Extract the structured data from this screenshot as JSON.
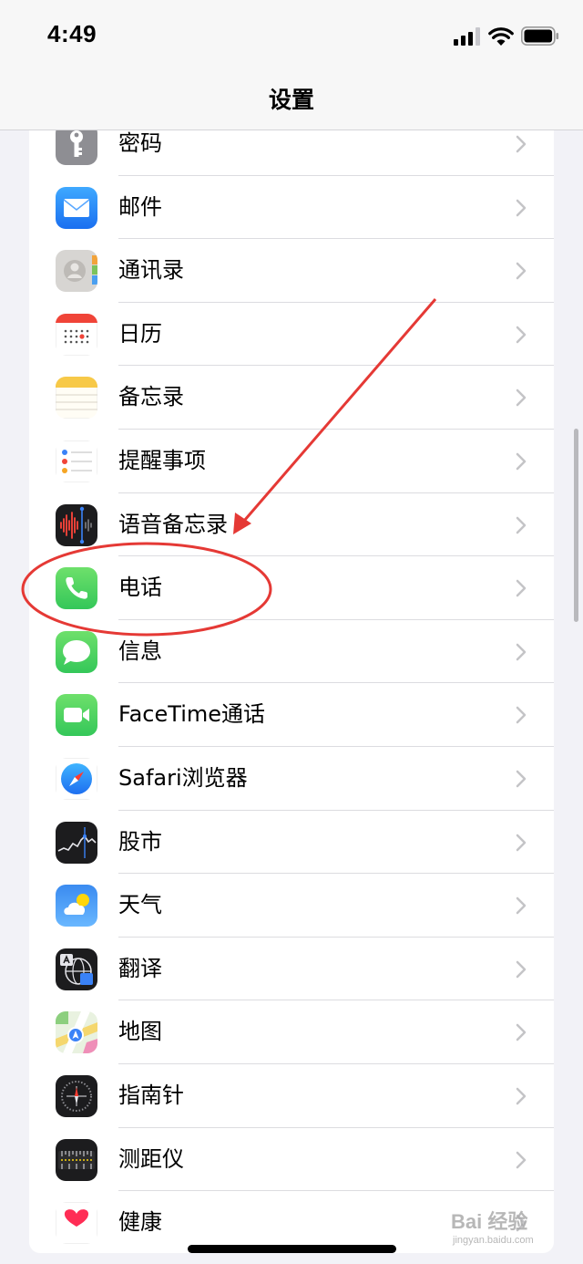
{
  "status_bar": {
    "time": "4:49"
  },
  "nav": {
    "title": "设置"
  },
  "items": [
    {
      "id": "passwords",
      "label": "密码",
      "icon": "key-icon"
    },
    {
      "id": "mail",
      "label": "邮件",
      "icon": "mail-icon"
    },
    {
      "id": "contacts",
      "label": "通讯录",
      "icon": "contacts-icon"
    },
    {
      "id": "calendar",
      "label": "日历",
      "icon": "calendar-icon"
    },
    {
      "id": "notes",
      "label": "备忘录",
      "icon": "notes-icon"
    },
    {
      "id": "reminders",
      "label": "提醒事项",
      "icon": "reminders-icon"
    },
    {
      "id": "voice-memos",
      "label": "语音备忘录",
      "icon": "waveform-icon"
    },
    {
      "id": "phone",
      "label": "电话",
      "icon": "phone-icon"
    },
    {
      "id": "messages",
      "label": "信息",
      "icon": "message-bubble-icon"
    },
    {
      "id": "facetime",
      "label": "FaceTime通话",
      "icon": "video-camera-icon"
    },
    {
      "id": "safari",
      "label": "Safari浏览器",
      "icon": "compass-icon"
    },
    {
      "id": "stocks",
      "label": "股市",
      "icon": "stocks-chart-icon"
    },
    {
      "id": "weather",
      "label": "天气",
      "icon": "weather-cloud-icon"
    },
    {
      "id": "translate",
      "label": "翻译",
      "icon": "translate-globe-icon"
    },
    {
      "id": "maps",
      "label": "地图",
      "icon": "map-icon"
    },
    {
      "id": "compass",
      "label": "指南针",
      "icon": "compass-dial-icon"
    },
    {
      "id": "measure",
      "label": "测距仪",
      "icon": "ruler-icon"
    },
    {
      "id": "health",
      "label": "健康",
      "icon": "heart-icon"
    }
  ],
  "annotation": {
    "color": "#e53935",
    "highlighted_item": "phone"
  },
  "watermark": {
    "brand": "Bai 经验",
    "url": "jingyan.baidu.com"
  }
}
